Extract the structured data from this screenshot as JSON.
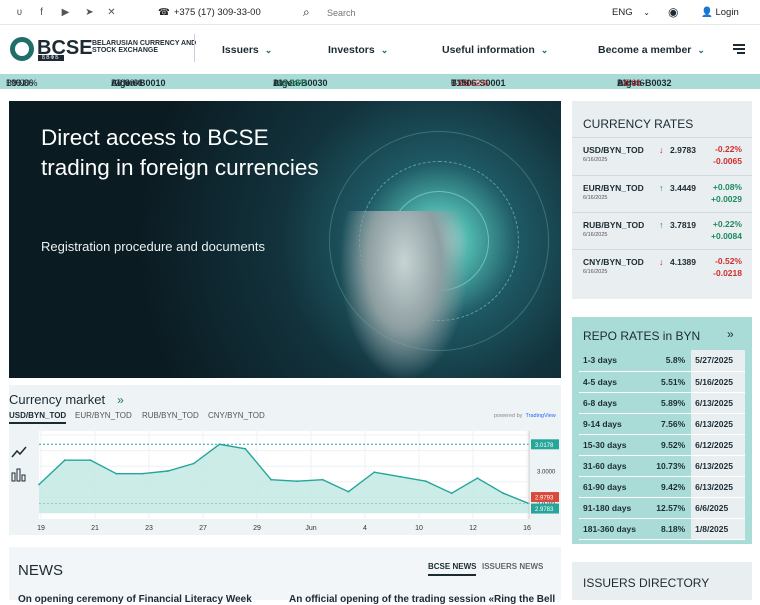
{
  "topbar": {
    "social_icons": [
      "vk-icon",
      "facebook-icon",
      "youtube-icon",
      "telegram-icon",
      "x-icon"
    ],
    "phone": "+375 (17) 309-33-00",
    "search_placeholder": "Search",
    "language": "ENG",
    "login": "Login"
  },
  "logo": {
    "mark": "BCSE",
    "sub": "БВФБ",
    "full_name": "BELARUSIAN CURRENCY AND STOCK EXCHANGE"
  },
  "nav": {
    "items": [
      "Issuers",
      "Investors",
      "Useful information",
      "Become a member"
    ]
  },
  "ticker": [
    {
      "sym": "",
      "price": "196.86",
      "cur": "BYN",
      "dir": "",
      "chg": "0.00%"
    },
    {
      "sym": "Aigen-B0010",
      "price": "203.00",
      "cur": "BYN",
      "dir": "",
      "chg": "0.00%"
    },
    {
      "sym": "Aigen-B0030",
      "price": "199.16",
      "cur": "BYN",
      "dir": "up",
      "chg": "+0.08%"
    },
    {
      "sym": "T1506-S0001",
      "price": "0.90",
      "cur": "BYN",
      "dir": "down",
      "chg": "-12.62%"
    },
    {
      "sym": "Aigen-B0032",
      "price": "204.46",
      "cur": "BYN",
      "dir": "",
      "chg": "-0.01"
    }
  ],
  "hero": {
    "title": "Direct access to BCSE trading in foreign currencies",
    "subtitle": "Registration procedure and documents"
  },
  "currency_market": {
    "title": "Currency market",
    "tabs": [
      "USD/BYN_TOD",
      "EUR/BYN_TOD",
      "RUB/BYN_TOD",
      "CNY/BYN_TOD"
    ],
    "active_tab": 0,
    "powered_by": "powered by",
    "provider": "TradingView"
  },
  "chart_data": {
    "type": "area",
    "series": [
      {
        "values": [
          2.991,
          3.0072,
          3.0072,
          2.9982,
          2.9982,
          3.0,
          3.005,
          3.0178,
          3.0148,
          2.9942,
          2.9932,
          2.9942,
          2.9862,
          2.9992,
          2.9962,
          2.9932,
          2.9852,
          2.9952,
          2.9852,
          2.9783
        ]
      }
    ],
    "x_tick_labels": [
      "19",
      "21",
      "23",
      "27",
      "29",
      "Jun",
      "4",
      "10",
      "12",
      "16"
    ],
    "y_tick_labels": [
      "3.0178",
      "3.0000",
      "2.9783"
    ],
    "markers": [
      "3.0178",
      "2.9793",
      "2.9783"
    ],
    "ylim": [
      2.972,
      3.024
    ],
    "grid": true
  },
  "news": {
    "title": "NEWS",
    "tabs": [
      "BCSE NEWS",
      "ISSUERS NEWS"
    ],
    "active_tab": 0,
    "headlines": [
      "On opening ceremony of Financial Literacy Week",
      "An official opening of the trading session «Ring the Bell"
    ]
  },
  "currency_rates": {
    "title": "CURRENCY RATES",
    "rows": [
      {
        "sym": "USD/BYN_TOD",
        "date": "6/16/2025",
        "dir": "down",
        "value": "2.9783",
        "pct": "-0.22%",
        "abs": "-0.0065"
      },
      {
        "sym": "EUR/BYN_TOD",
        "date": "6/16/2025",
        "dir": "up",
        "value": "3.4449",
        "pct": "+0.08%",
        "abs": "+0.0029"
      },
      {
        "sym": "RUB/BYN_TOD",
        "date": "6/16/2025",
        "dir": "up",
        "value": "3.7819",
        "pct": "+0.22%",
        "abs": "+0.0084"
      },
      {
        "sym": "CNY/BYN_TOD",
        "date": "6/16/2025",
        "dir": "down",
        "value": "4.1389",
        "pct": "-0.52%",
        "abs": "-0.0218"
      }
    ]
  },
  "repo_rates": {
    "title": "REPO RATES in BYN",
    "rows": [
      {
        "term": "1-3 days",
        "rate": "5.8%",
        "date": "5/27/2025"
      },
      {
        "term": "4-5 days",
        "rate": "5.51%",
        "date": "5/16/2025"
      },
      {
        "term": "6-8 days",
        "rate": "5.89%",
        "date": "6/13/2025"
      },
      {
        "term": "9-14 days",
        "rate": "7.56%",
        "date": "6/13/2025"
      },
      {
        "term": "15-30 days",
        "rate": "9.52%",
        "date": "6/12/2025"
      },
      {
        "term": "31-60 days",
        "rate": "10.73%",
        "date": "6/13/2025"
      },
      {
        "term": "61-90 days",
        "rate": "9.42%",
        "date": "6/13/2025"
      },
      {
        "term": "91-180 days",
        "rate": "12.57%",
        "date": "6/6/2025"
      },
      {
        "term": "181-360 days",
        "rate": "8.18%",
        "date": "1/8/2025"
      }
    ]
  },
  "issuers_directory": {
    "title": "ISSUERS DIRECTORY"
  },
  "colors": {
    "accent": "#1f6e6a",
    "ticker_bg": "#a9dcd6",
    "up": "#1f8a5f",
    "down": "#d22d2d"
  }
}
